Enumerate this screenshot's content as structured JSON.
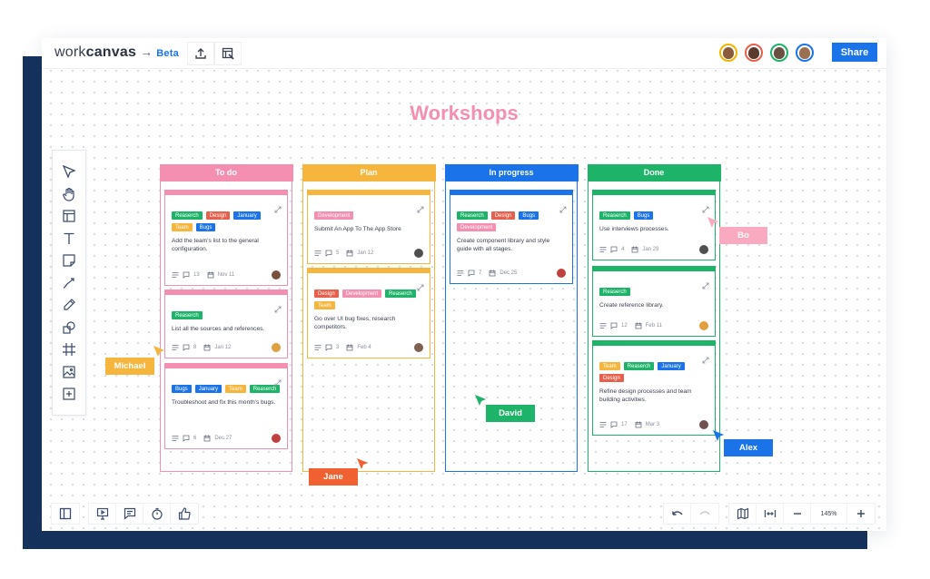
{
  "app": {
    "logo_light": "work",
    "logo_bold": "canvas",
    "logo_arrow": "→",
    "logo_beta": "Beta",
    "share_label": "Share",
    "colors": {
      "accent": "#1a73e8",
      "backdrop": "#15325c"
    }
  },
  "topbar": {
    "icons": [
      "upload-icon",
      "board-select-icon"
    ],
    "avatars": [
      {
        "name": "user-1",
        "ring": "#f4b400",
        "face": "#8a5a3c"
      },
      {
        "name": "user-2",
        "ring": "#e8604c",
        "face": "#5a3a2c"
      },
      {
        "name": "user-3",
        "ring": "#1db368",
        "face": "#6a5040"
      },
      {
        "name": "user-4",
        "ring": "#1a73e8",
        "face": "#9a7050"
      }
    ]
  },
  "board": {
    "title": "Workshops",
    "columns": [
      {
        "name": "To do",
        "color": "#f48fb1",
        "cards": [
          {
            "tags": [
              {
                "label": "Reaserch",
                "color": "#1db368"
              },
              {
                "label": "Design",
                "color": "#e8604c"
              },
              {
                "label": "January",
                "color": "#1a73e8"
              },
              {
                "label": "Team",
                "color": "#f6b53d"
              },
              {
                "label": "Bugs",
                "color": "#1a73e8"
              }
            ],
            "text": "Add the team's list to the general configuration.",
            "comments": "13",
            "date": "Nov 11",
            "avatar": "#7a5040"
          },
          {
            "tags": [
              {
                "label": "Reaserch",
                "color": "#1db368"
              }
            ],
            "text": "List all the sources and references.",
            "comments": "8",
            "date": "Jan 12",
            "avatar": "#e0a040"
          },
          {
            "tags": [
              {
                "label": "Bugs",
                "color": "#1a73e8"
              },
              {
                "label": "January",
                "color": "#1a73e8"
              },
              {
                "label": "Team",
                "color": "#f6b53d"
              },
              {
                "label": "Reaserch",
                "color": "#1db368"
              }
            ],
            "text": "Troubleshoot and fix this month's bugs.",
            "comments": "6",
            "date": "Dec 27",
            "avatar": "#c04040"
          }
        ]
      },
      {
        "name": "Plan",
        "color": "#f6b53d",
        "cards": [
          {
            "tags": [
              {
                "label": "Development",
                "color": "#f48fb1"
              }
            ],
            "text": "Submit An App To The App Store",
            "comments": "5",
            "date": "Jan 12",
            "avatar": "#505050"
          },
          {
            "tags": [
              {
                "label": "Design",
                "color": "#e8604c"
              },
              {
                "label": "Development",
                "color": "#f48fb1"
              },
              {
                "label": "Reaserch",
                "color": "#1db368"
              },
              {
                "label": "Team",
                "color": "#f6b53d"
              }
            ],
            "text": "Go over UI bug fixes, research competitors.",
            "comments": "3",
            "date": "Feb 4",
            "avatar": "#806050"
          }
        ]
      },
      {
        "name": "In progress",
        "color": "#1a73e8",
        "cards": [
          {
            "tags": [
              {
                "label": "Reaserch",
                "color": "#1db368"
              },
              {
                "label": "Design",
                "color": "#e8604c"
              },
              {
                "label": "Bugs",
                "color": "#1a73e8"
              },
              {
                "label": "Development",
                "color": "#f48fb1"
              }
            ],
            "text": "Create component library and style guide with all stages.",
            "comments": "7",
            "date": "Dec 25",
            "avatar": "#c04040"
          }
        ]
      },
      {
        "name": "Done",
        "color": "#1db368",
        "cards": [
          {
            "tags": [
              {
                "label": "Reaserch",
                "color": "#1db368"
              },
              {
                "label": "Bugs",
                "color": "#1a73e8"
              }
            ],
            "text": "Use interviews processes.",
            "comments": "4",
            "date": "Jan 29",
            "avatar": "#505050"
          },
          {
            "tags": [
              {
                "label": "Reaserch",
                "color": "#1db368"
              }
            ],
            "text": "Create reference library.",
            "comments": "12",
            "date": "Feb 11",
            "avatar": "#e0a040"
          },
          {
            "tags": [
              {
                "label": "Team",
                "color": "#f6b53d"
              },
              {
                "label": "Reaserch",
                "color": "#1db368"
              },
              {
                "label": "January",
                "color": "#1a73e8"
              },
              {
                "label": "Design",
                "color": "#e8604c"
              }
            ],
            "text": "Refine design processes and team building activities.",
            "comments": "17",
            "date": "Mar 3",
            "avatar": "#705050"
          }
        ]
      }
    ]
  },
  "cursors": [
    {
      "name": "Michael",
      "color": "#f6b53d"
    },
    {
      "name": "Jane",
      "color": "#f06030"
    },
    {
      "name": "David",
      "color": "#1db368"
    },
    {
      "name": "Bo",
      "color": "#f9aac0"
    },
    {
      "name": "Alex",
      "color": "#1a73e8"
    }
  ],
  "toolbox": [
    "select-icon",
    "hand-icon",
    "template-icon",
    "text-icon",
    "sticky-note-icon",
    "connector-icon",
    "pen-icon",
    "shapes-icon",
    "frame-icon",
    "image-icon",
    "add-icon"
  ],
  "bottombar": {
    "left": [
      "sidebar-toggle-icon"
    ],
    "collab": [
      "present-icon",
      "comment-icon",
      "timer-icon",
      "vote-icon"
    ],
    "history": [
      "undo-icon",
      "redo-icon"
    ],
    "view": [
      "map-icon",
      "fit-width-icon",
      "zoom-out-icon"
    ],
    "zoom_level": "145%",
    "zoom_in": "zoom-in-icon"
  }
}
